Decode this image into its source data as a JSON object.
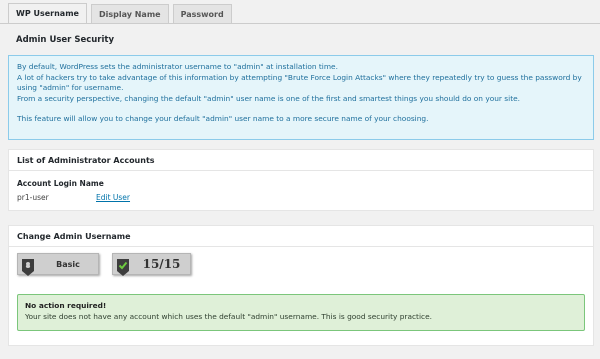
{
  "tabs": [
    {
      "label": "WP Username",
      "active": true
    },
    {
      "label": "Display Name",
      "active": false
    },
    {
      "label": "Password",
      "active": false
    }
  ],
  "section_title": "Admin User Security",
  "info": {
    "line1": "By default, WordPress sets the administrator username to \"admin\" at installation time.",
    "line2": "A lot of hackers try to take advantage of this information by attempting \"Brute Force Login Attacks\" where they repeatedly try to guess the password by using \"admin\" for username.",
    "line3": "From a security perspective, changing the default \"admin\" user name is one of the first and smartest things you should do on your site.",
    "line4": "This feature will allow you to change your default \"admin\" user name to a more secure name of your choosing."
  },
  "accounts": {
    "title": "List of Administrator Accounts",
    "column_header": "Account Login Name",
    "rows": [
      {
        "login": "pr1-user",
        "action": "Edit User"
      }
    ]
  },
  "change": {
    "title": "Change Admin Username",
    "badge_level": "Basic",
    "badge_score": "15/15",
    "result_title": "No action required!",
    "result_text": "Your site does not have any account which uses the default \"admin\" username. This is good security practice."
  },
  "icons": {
    "basic_badge": "shield-icon",
    "score_badge": "shield-check-icon"
  },
  "colors": {
    "info_bg": "#e5f5fa",
    "info_text": "#1e6f9c",
    "success_bg": "#dff0d8",
    "success_border": "#7bc67b",
    "link": "#0073aa"
  }
}
